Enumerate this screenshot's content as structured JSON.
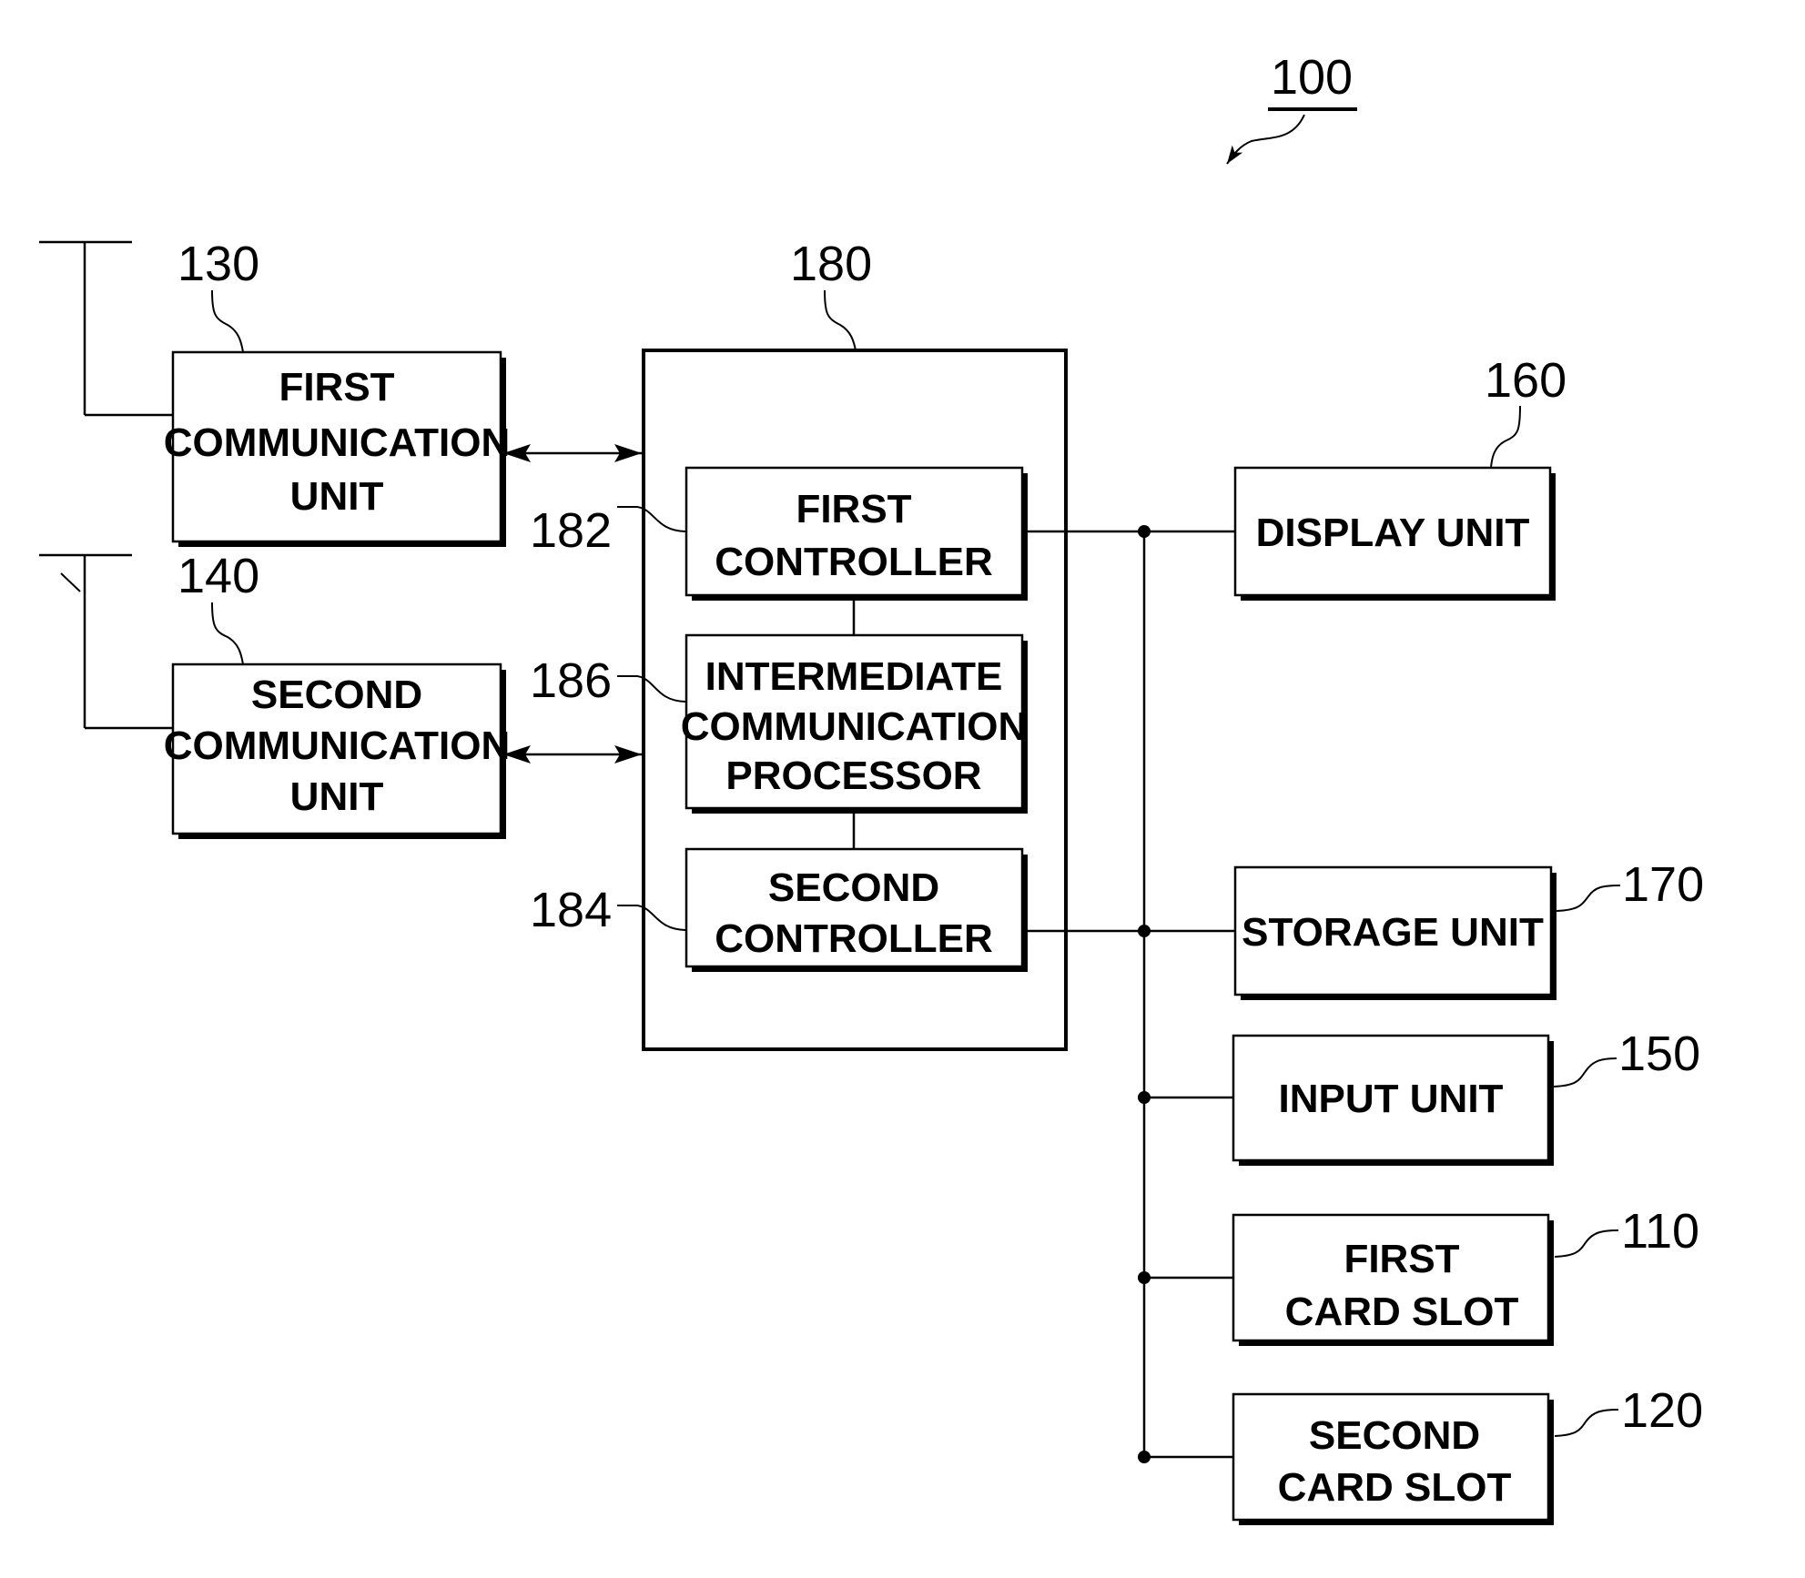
{
  "figure_ref": "100",
  "blocks": {
    "first_comm": {
      "ref": "130",
      "lines": [
        "FIRST",
        "COMMUNICATION",
        "UNIT"
      ]
    },
    "second_comm": {
      "ref": "140",
      "lines": [
        "SECOND",
        "COMMUNICATION",
        "UNIT"
      ]
    },
    "control": {
      "ref": "180"
    },
    "first_controller": {
      "ref": "182",
      "lines": [
        "FIRST",
        "CONTROLLER"
      ]
    },
    "intermediate": {
      "ref": "186",
      "lines": [
        "INTERMEDIATE",
        "COMMUNICATION",
        "PROCESSOR"
      ]
    },
    "second_controller": {
      "ref": "184",
      "lines": [
        "SECOND",
        "CONTROLLER"
      ]
    },
    "display": {
      "ref": "160",
      "lines": [
        "DISPLAY UNIT"
      ]
    },
    "storage": {
      "ref": "170",
      "lines": [
        "STORAGE UNIT"
      ]
    },
    "input": {
      "ref": "150",
      "lines": [
        "INPUT UNIT"
      ]
    },
    "first_card_slot": {
      "ref": "110",
      "lines": [
        "FIRST",
        "CARD SLOT"
      ]
    },
    "second_card_slot": {
      "ref": "120",
      "lines": [
        "SECOND",
        "CARD SLOT"
      ]
    }
  }
}
